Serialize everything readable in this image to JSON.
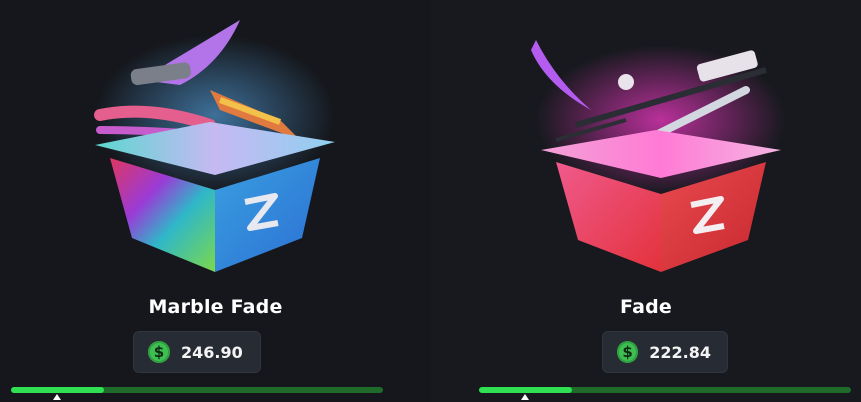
{
  "cases": [
    {
      "name": "Marble Fade",
      "price": "246.90",
      "currency_icon": "dollar-coin-icon",
      "progress": 0.25,
      "colors": {
        "accent": "#2ee052",
        "track": "#1f6b2a",
        "coin": "#3fbf52"
      }
    },
    {
      "name": "Fade",
      "price": "222.84",
      "currency_icon": "dollar-coin-icon",
      "progress": 0.25,
      "colors": {
        "accent": "#2ee052",
        "track": "#1f6b2a",
        "coin": "#3fbf52"
      }
    }
  ]
}
